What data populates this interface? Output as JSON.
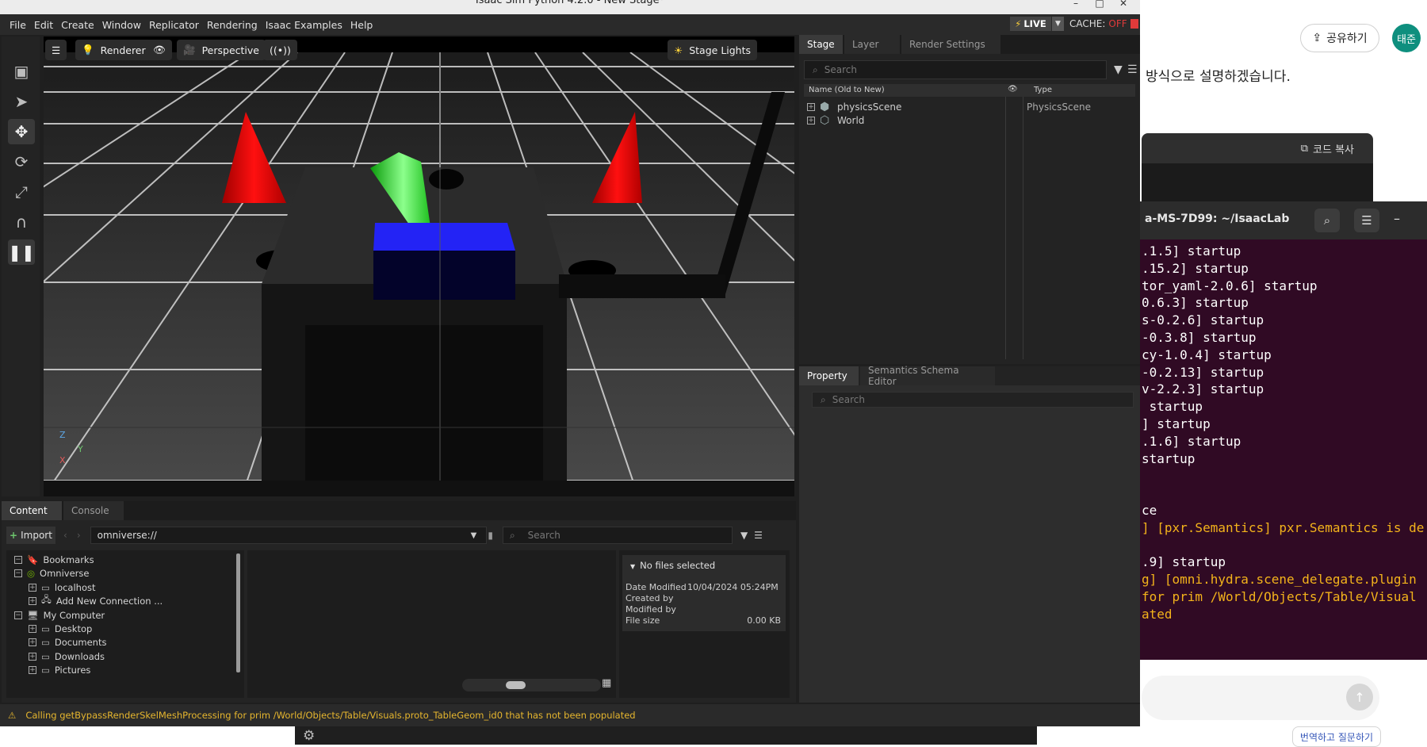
{
  "browser": {
    "share_label": "공유하기",
    "avatar_label": "태준",
    "korean_text": "방식으로 설명하겠습니다.",
    "code_copy_label": "코드 복사",
    "translate_label": "번역하고 질문하기"
  },
  "terminal": {
    "title": "a-MS-7D99: ~/IsaacLab",
    "lines": [
      {
        "text": ".1.5] startup",
        "color": "white"
      },
      {
        "text": ".15.2] startup",
        "color": "white"
      },
      {
        "text": "tor_yaml-2.0.6] startup",
        "color": "white"
      },
      {
        "text": "0.6.3] startup",
        "color": "white"
      },
      {
        "text": "s-0.2.6] startup",
        "color": "white"
      },
      {
        "text": "-0.3.8] startup",
        "color": "white"
      },
      {
        "text": "cy-1.0.4] startup",
        "color": "white"
      },
      {
        "text": "-0.2.13] startup",
        "color": "white"
      },
      {
        "text": "v-2.2.3] startup",
        "color": "white"
      },
      {
        "text": " startup",
        "color": "white"
      },
      {
        "text": "] startup",
        "color": "white"
      },
      {
        "text": ".1.6] startup",
        "color": "white"
      },
      {
        "text": "startup",
        "color": "white"
      },
      {
        "text": "",
        "color": "white"
      },
      {
        "text": "",
        "color": "white"
      },
      {
        "text": "ce",
        "color": "white"
      },
      {
        "text": "] [pxr.Semantics] pxr.Semantics is de",
        "color": "yellow"
      },
      {
        "text": "",
        "color": "white"
      },
      {
        "text": ".9] startup",
        "color": "white"
      },
      {
        "text": "g] [omni.hydra.scene_delegate.plugin",
        "color": "yellow"
      },
      {
        "text": "for prim /World/Objects/Table/Visual",
        "color": "yellow"
      },
      {
        "text": "ated",
        "color": "yellow"
      }
    ]
  },
  "isaac": {
    "title": "Isaac Sim Python 4.2.0 - New Stage*",
    "menu": [
      "File",
      "Edit",
      "Create",
      "Window",
      "Replicator",
      "Rendering",
      "Isaac Examples",
      "Help"
    ],
    "live_label": "LIVE",
    "cache_label": "CACHE:",
    "cache_state": "OFF",
    "viewport": {
      "renderer_label": "Renderer",
      "camera_label": "Perspective",
      "lights_label": "Stage Lights",
      "axis_z": "Z",
      "axis_y": "Y",
      "axis_x": "X"
    },
    "stage": {
      "tabs": [
        "Stage",
        "Layer",
        "Render Settings"
      ],
      "search_placeholder": "Search",
      "col_name": "Name (Old to New)",
      "col_type": "Type",
      "rows": [
        {
          "name": "physicsScene",
          "type": "PhysicsScene"
        },
        {
          "name": "World",
          "type": ""
        }
      ]
    },
    "property": {
      "tabs": [
        "Property",
        "Semantics Schema Editor"
      ],
      "search_placeholder": "Search"
    },
    "content": {
      "tabs": [
        "Content",
        "Console"
      ],
      "import_label": "Import",
      "path": "omniverse://",
      "search_placeholder": "Search",
      "tree": [
        {
          "label": "Bookmarks",
          "level": 0,
          "icon": "bookmark-icon"
        },
        {
          "label": "Omniverse",
          "level": 0,
          "icon": "omniverse-icon"
        },
        {
          "label": "localhost",
          "level": 1,
          "icon": "drive-icon"
        },
        {
          "label": "Add New Connection ...",
          "level": 1,
          "icon": "server-icon"
        },
        {
          "label": "My Computer",
          "level": 0,
          "icon": "computer-icon"
        },
        {
          "label": "Desktop",
          "level": 1,
          "icon": "drive-icon"
        },
        {
          "label": "Documents",
          "level": 1,
          "icon": "drive-icon"
        },
        {
          "label": "Downloads",
          "level": 1,
          "icon": "drive-icon"
        },
        {
          "label": "Pictures",
          "level": 1,
          "icon": "drive-icon"
        }
      ],
      "info": {
        "header": "No files selected",
        "date_modified_label": "Date Modified",
        "date_modified": "10/04/2024 05:24PM",
        "created_by_label": "Created by",
        "modified_by_label": "Modified by",
        "file_size_label": "File size",
        "file_size": "0.00 KB"
      }
    },
    "status_message": "Calling getBypassRenderSkelMeshProcessing for prim /World/Objects/Table/Visuals.proto_TableGeom_id0 that has not been populated"
  },
  "colors": {
    "accent_green": "#2fd12f",
    "cone_red": "#d90c0c",
    "box_blue": "#1a1ae6",
    "warning_yellow": "#e6b62e",
    "terminal_bg": "#300a24"
  }
}
